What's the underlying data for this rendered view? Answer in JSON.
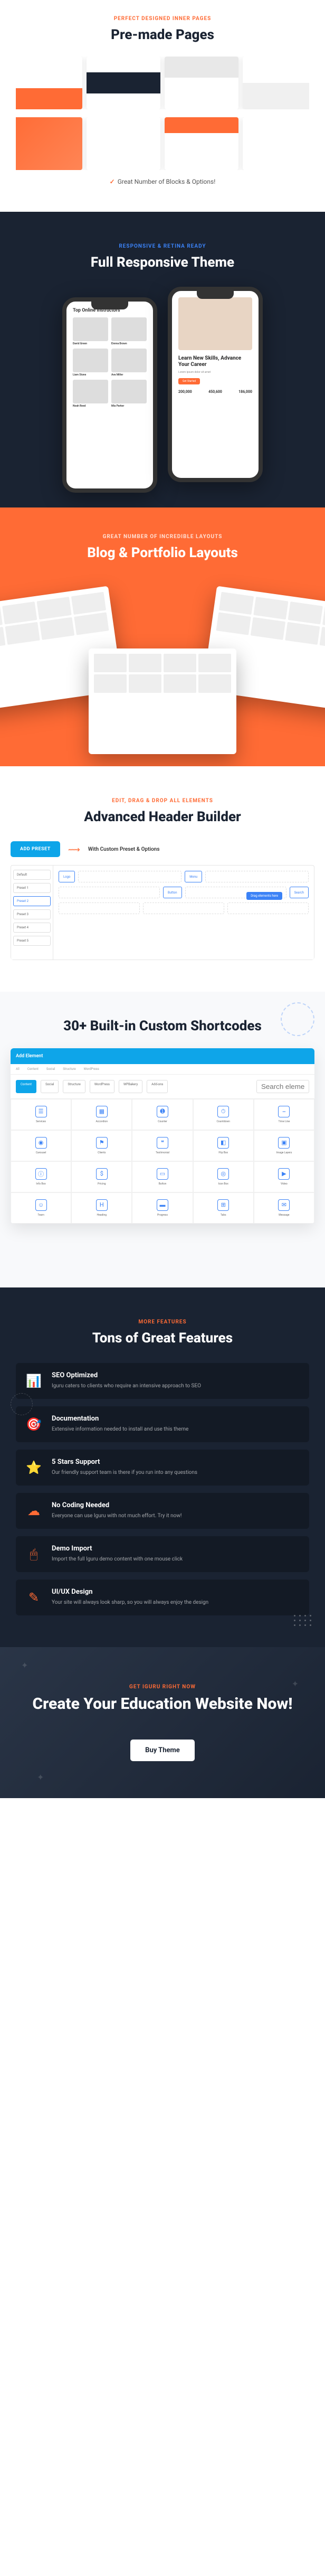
{
  "s1": {
    "eyebrow": "PERFECT DESIGNED INNER PAGES",
    "heading": "Pre-made Pages",
    "check_text": "Great Number of Blocks & Options!"
  },
  "s2": {
    "eyebrow": "RESPONSIVE & RETINA READY",
    "heading": "Full Responsive Theme",
    "phone1_title": "Top Online Instructors",
    "instructors": [
      "David Green",
      "Emma Brown",
      "Liam Stone",
      "Ava Miller",
      "Noah Reed",
      "Mia Parker"
    ],
    "phone2_title": "Learn New Skills, Advance Your Career",
    "phone2_btn": "Get Started",
    "stats": [
      "200,000",
      "450,600",
      "186,000"
    ]
  },
  "s3": {
    "eyebrow": "GREAT NUMBER OF INCREDIBLE LAYOUTS",
    "heading": "Blog & Portfolio Layouts"
  },
  "s4": {
    "eyebrow": "EDIT, DRAG & DROP ALL ELEMENTS",
    "heading": "Advanced Header Builder",
    "add_preset": "ADD PRESET",
    "preset_label": "With Custom Preset & Options",
    "sidebar_items": [
      "Default",
      "Preset 1",
      "Preset 2",
      "Preset 3",
      "Preset 4",
      "Preset 5"
    ],
    "chips": [
      "Logo",
      "Menu",
      "Button",
      "Search"
    ],
    "tooltip": "Drag elements here"
  },
  "s5": {
    "heading": "30+ Built-in Custom Shortcodes",
    "window_title": "Add Element",
    "toolbar": [
      "All",
      "Content",
      "Social",
      "Structure",
      "WordPress"
    ],
    "filters": [
      "Content",
      "Social",
      "Structure",
      "WordPress",
      "WPBakery",
      "Add-ons"
    ],
    "search_placeholder": "Search element",
    "shortcodes": [
      "Services",
      "Accordion",
      "Counter",
      "Countdown",
      "Time Line",
      "Carousel",
      "Clients",
      "Testimonial",
      "Flip Box",
      "Image Layers",
      "Info Box",
      "Pricing",
      "Button",
      "Icon Box",
      "Video",
      "Team",
      "Heading",
      "Progress",
      "Tabs",
      "Message"
    ]
  },
  "s6": {
    "eyebrow": "MORE FEATURES",
    "heading": "Tons of Great Features",
    "features": [
      {
        "title": "SEO Optimized",
        "desc": "Iguru caters to clients who require an intensive approach to SEO"
      },
      {
        "title": "Documentation",
        "desc": "Extensive information needed to install and use this theme"
      },
      {
        "title": "5 Stars Support",
        "desc": "Our friendly support team is there if you run into any questions"
      },
      {
        "title": "No Coding Needed",
        "desc": "Everyone can use Iguru with not much effort. Try it now!"
      },
      {
        "title": "Demo Import",
        "desc": "Import the full Iguru demo content with one mouse click"
      },
      {
        "title": "UI/UX Design",
        "desc": "Your site will always look sharp, so you will always enjoy the design"
      }
    ]
  },
  "s7": {
    "eyebrow": "GET IGURU RIGHT NOW",
    "heading": "Create Your Education Website Now!",
    "button": "Buy Theme"
  }
}
